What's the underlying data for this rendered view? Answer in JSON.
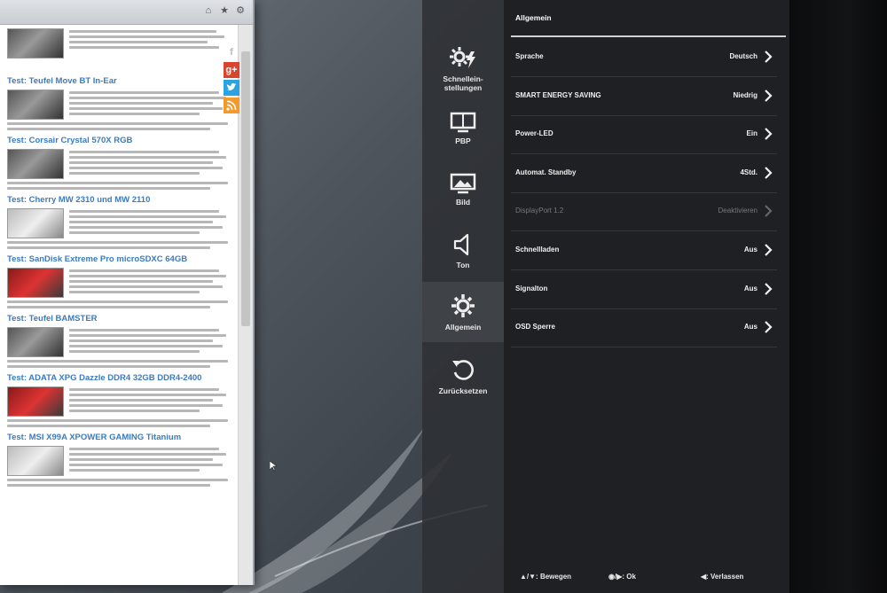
{
  "browser": {
    "toolbar_icons": [
      "home-icon",
      "star-icon",
      "gear-icon"
    ],
    "social_icons": [
      "facebook-icon",
      "google-plus-icon",
      "twitter-icon",
      "rss-icon"
    ],
    "social_labels": {
      "facebook": "f",
      "google_plus": "g+"
    },
    "articles": [
      {
        "title": "Test: Teufel Move BT In-Ear",
        "thumb": "dark"
      },
      {
        "title": "Test: Corsair Crystal 570X RGB",
        "thumb": "dark"
      },
      {
        "title": "Test: Cherry MW 2310 und MW 2110",
        "thumb": "light"
      },
      {
        "title": "Test: SanDisk Extreme Pro microSDXC 64GB",
        "thumb": "red"
      },
      {
        "title": "Test: Teufel BAMSTER",
        "thumb": "dark"
      },
      {
        "title": "Test: ADATA XPG Dazzle DDR4 32GB DDR4-2400",
        "thumb": "red"
      },
      {
        "title": "Test: MSI X99A XPOWER GAMING Titanium",
        "thumb": "light"
      }
    ]
  },
  "osd": {
    "categories": [
      {
        "label_line1": "Schnellein-",
        "label_line2": "stellungen",
        "icon": "quick-settings-icon",
        "active": false
      },
      {
        "label_line1": "PBP",
        "label_line2": "",
        "icon": "pbp-icon",
        "active": false
      },
      {
        "label_line1": "Bild",
        "label_line2": "",
        "icon": "picture-icon",
        "active": false
      },
      {
        "label_line1": "Ton",
        "label_line2": "",
        "icon": "speaker-icon",
        "active": false
      },
      {
        "label_line1": "Allgemein",
        "label_line2": "",
        "icon": "gear-icon",
        "active": true
      },
      {
        "label_line1": "Zurücksetzen",
        "label_line2": "",
        "icon": "reset-icon",
        "active": false
      }
    ],
    "header": "Allgemein",
    "settings": [
      {
        "label": "Sprache",
        "value": "Deutsch",
        "enabled": true
      },
      {
        "label": "SMART ENERGY SAVING",
        "value": "Niedrig",
        "enabled": true
      },
      {
        "label": "Power-LED",
        "value": "Ein",
        "enabled": true
      },
      {
        "label": "Automat. Standby",
        "value": "4Std.",
        "enabled": true
      },
      {
        "label": "DisplayPort 1.2",
        "value": "Deaktivieren",
        "enabled": false
      },
      {
        "label": "Schnellladen",
        "value": "Aus",
        "enabled": true
      },
      {
        "label": "Signalton",
        "value": "Aus",
        "enabled": true
      },
      {
        "label": "OSD Sperre",
        "value": "Aus",
        "enabled": true
      }
    ],
    "footer": {
      "move": "▲/▼: Bewegen",
      "ok": "◉/▶: Ok",
      "exit": "◀: Verlassen"
    }
  }
}
